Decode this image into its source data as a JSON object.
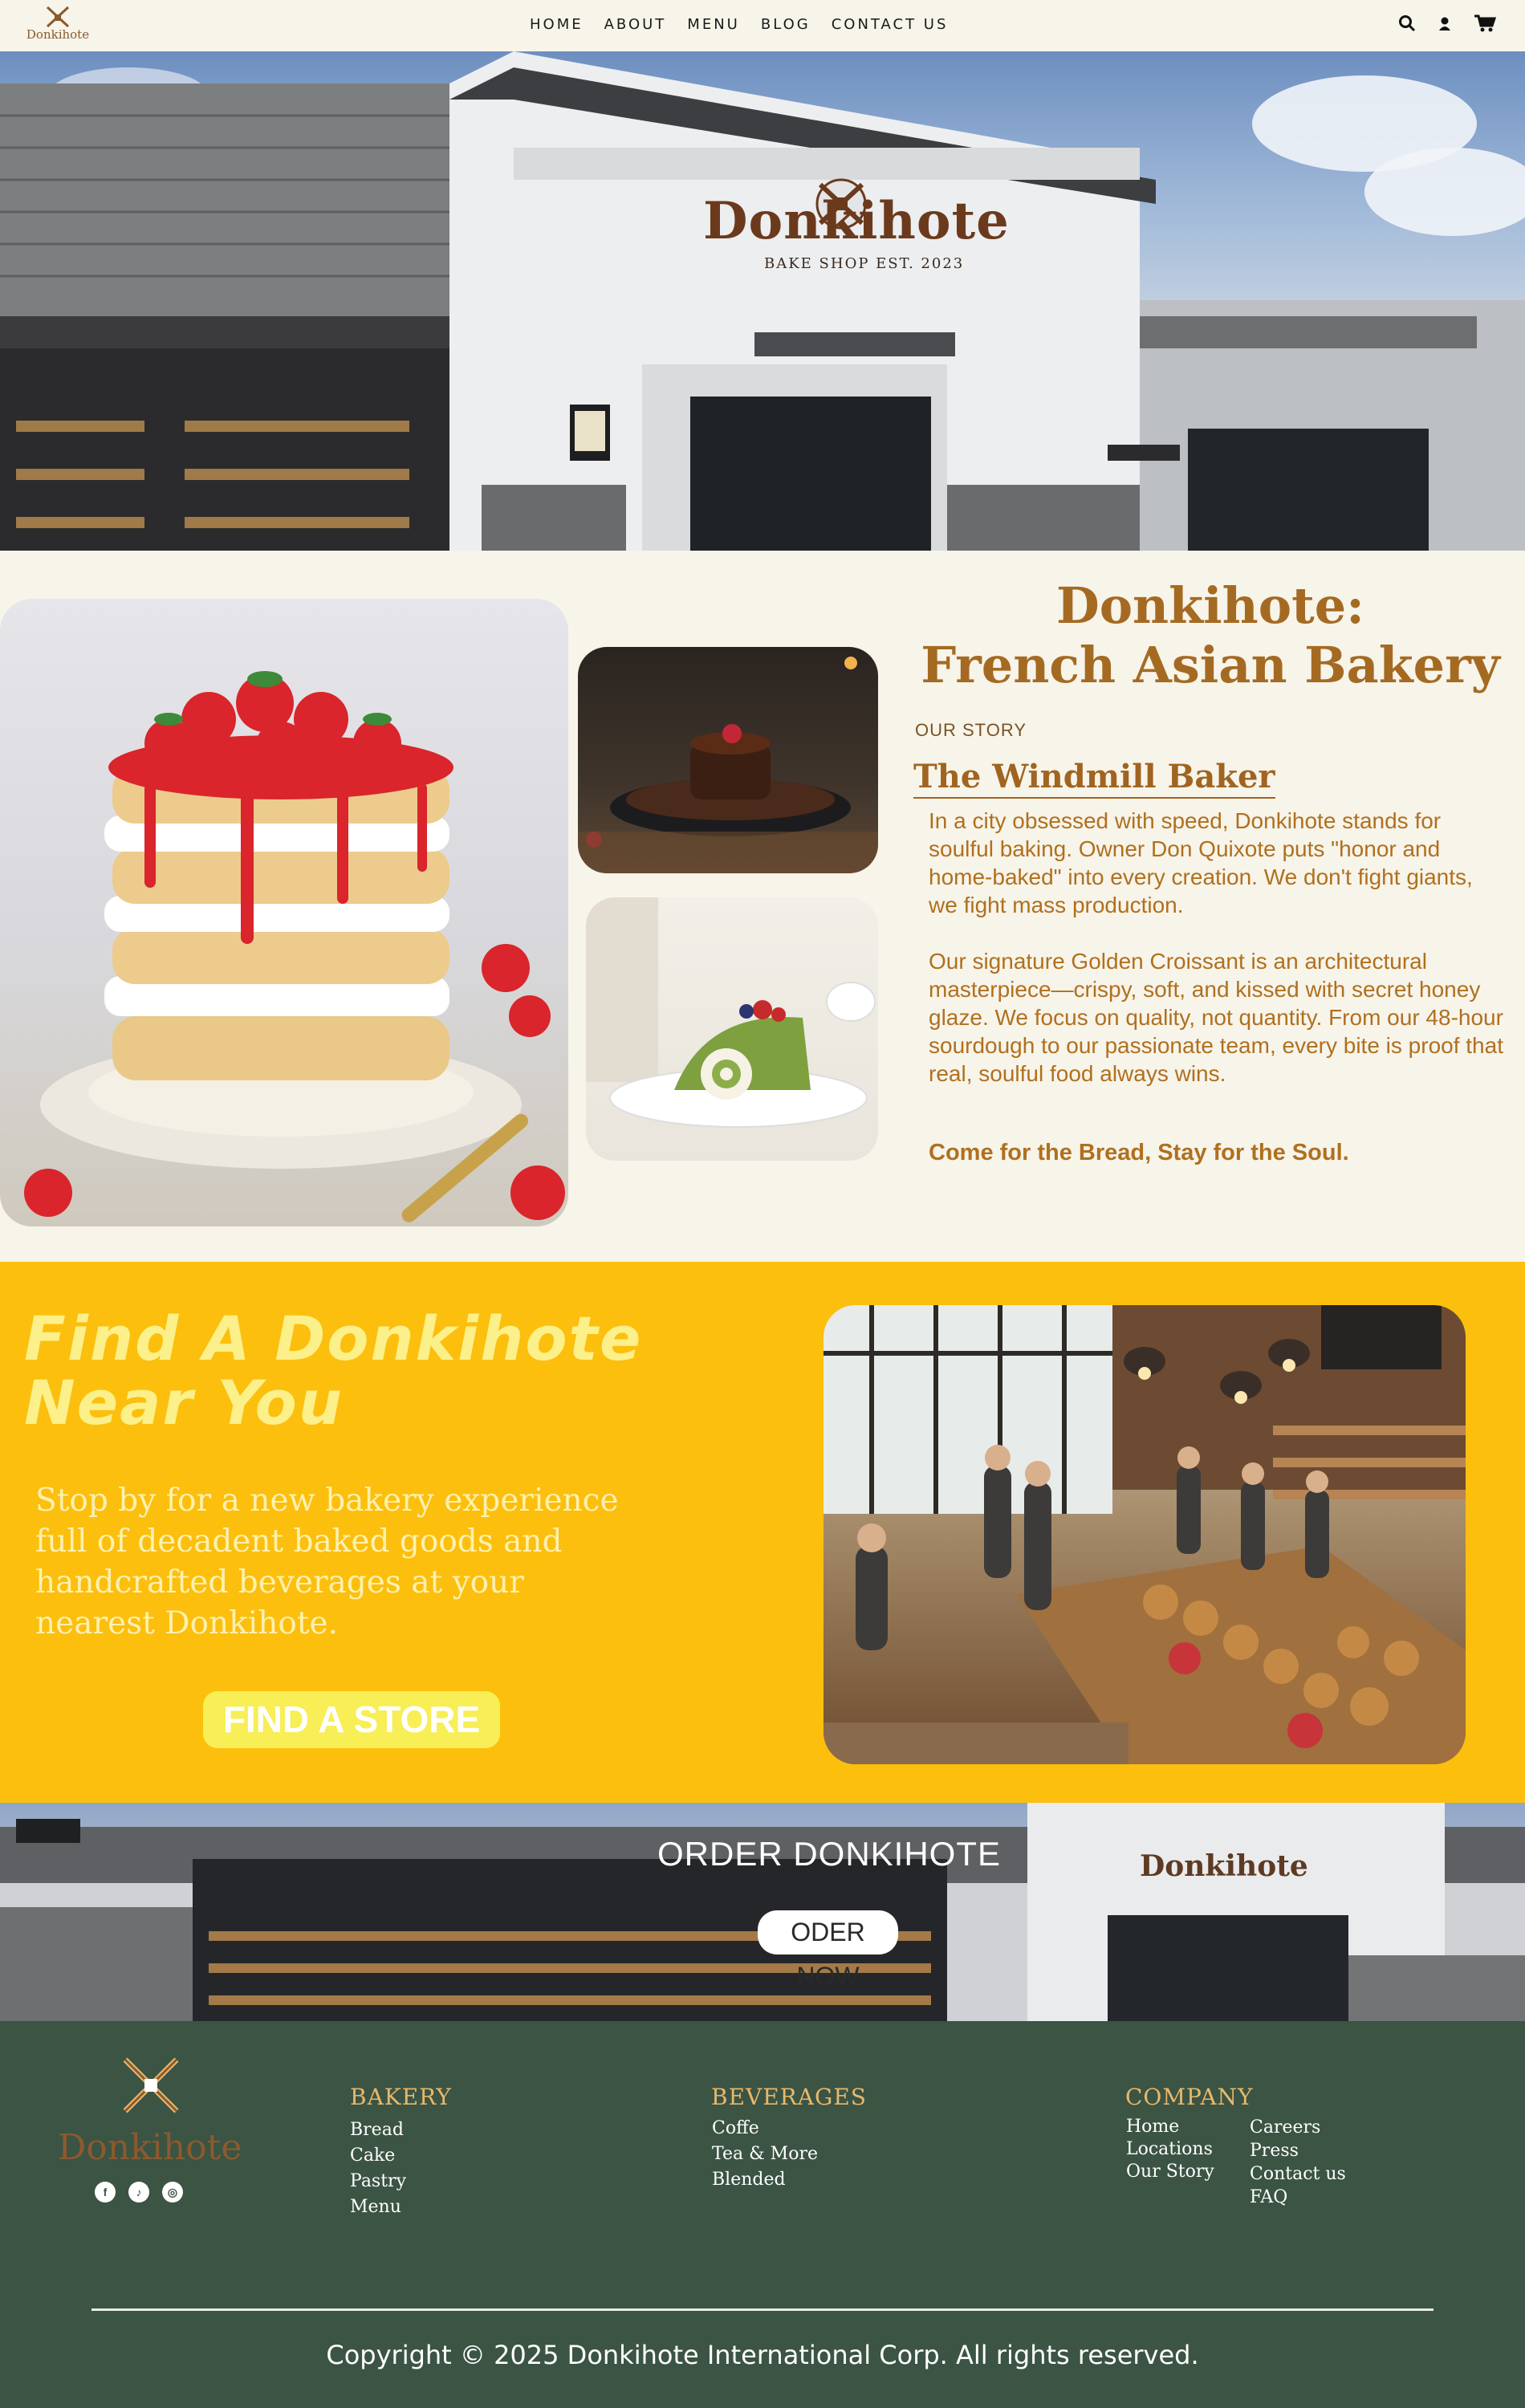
{
  "nav": {
    "logo_text": "Donkihote",
    "links": [
      "HOME",
      "ABOUT",
      "MENU",
      "BLOG",
      "CONTACT US"
    ],
    "icons": [
      "search-icon",
      "user-icon",
      "cart-icon"
    ]
  },
  "hero": {
    "shop_name": "Donkihote",
    "shop_sub": "BAKE SHOP EST. 2023"
  },
  "story": {
    "title_line1": "Donkihote:",
    "title_line2": "French Asian Bakery",
    "eyebrow": "OUR STORY",
    "heading": "The Windmill Baker",
    "para1": "In a city obsessed with speed, Donkihote stands for soulful baking. Owner Don Quixote puts \"honor and home-baked\" into every creation. We don't fight giants, we fight mass production.",
    "para2": "Our signature Golden Croissant is an architectural masterpiece—crispy, soft, and kissed with secret honey glaze. We focus on quality, not quantity. From our 48-hour sourdough to our passionate team, every bite is proof that real, soulful food always wins.",
    "tagline": "Come for the Bread, Stay for the Soul."
  },
  "find": {
    "title": "Find A Donkihote Near You",
    "text": "Stop by for a new bakery experience full of decadent baked goods and handcrafted beverages at your nearest Donkihote.",
    "button": "FIND A STORE"
  },
  "order": {
    "title": "ORDER DONKIHOTE",
    "button": "ODER NOW",
    "sign": "Donkihote"
  },
  "footer": {
    "brand": "Donkihote",
    "social": [
      "facebook-icon",
      "tiktok-icon",
      "instagram-icon"
    ],
    "bakery": {
      "heading": "BAKERY",
      "items": [
        "Bread",
        "Cake",
        "Pastry",
        "Menu"
      ]
    },
    "beverages": {
      "heading": "BEVERAGES",
      "items": [
        "Coffe",
        "Tea & More",
        "Blended"
      ]
    },
    "company": {
      "heading": "COMPANY",
      "col1": [
        "Home",
        "Locations",
        "Our Story"
      ],
      "col2": [
        "Careers",
        "Press",
        "Contact us",
        "FAQ"
      ]
    },
    "copyright": "Copyright © 2025 Donkihote International Corp. All rights reserved."
  },
  "colors": {
    "cream": "#f7f4ea",
    "brand_brown": "#a56a22",
    "yellow": "#fcbf0e",
    "footer_green": "#3b5444"
  }
}
